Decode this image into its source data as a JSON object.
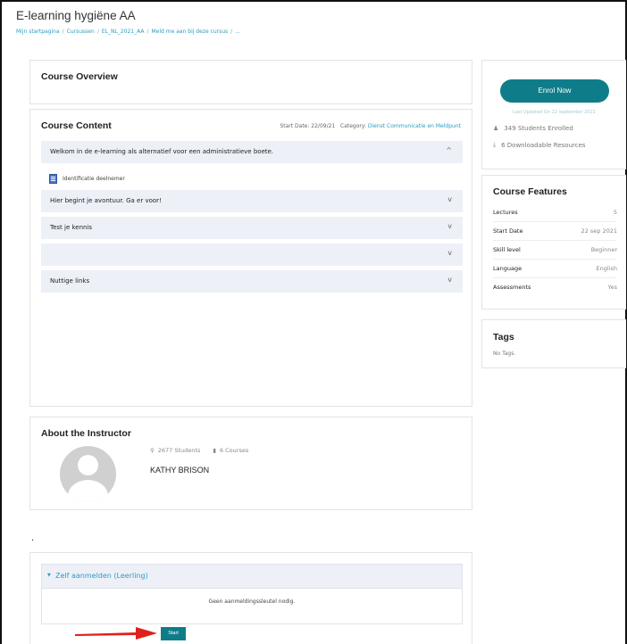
{
  "page": {
    "title": "E-learning hygiëne AA",
    "breadcrumb": [
      "Mijn startpagina",
      "Cursussen",
      "EL_NL_2021_AA",
      "Meld me aan bij deze cursus",
      "..."
    ]
  },
  "overview": {
    "title": "Course Overview"
  },
  "content": {
    "title": "Course Content",
    "start_label": "Start Date: 22/09/21",
    "category_label": "Category:",
    "category": "Dienst Communicatie en Meldpunt",
    "sections": [
      {
        "label": "Welkom in de e-learning als alternatief voor een administratieve boete.",
        "chevron": "^"
      },
      {
        "label": "Hier begint je avontuur. Ga er voor!",
        "chevron": "v"
      },
      {
        "label": "Test je kennis",
        "chevron": "v"
      },
      {
        "label": "",
        "chevron": "v"
      },
      {
        "label": "Nuttige links",
        "chevron": "v"
      }
    ],
    "activity": "Identificatie deelnemer"
  },
  "instructor": {
    "title": "About the Instructor",
    "students": "2677 Students",
    "courses": "6 Courses",
    "name": "KATHY BRISON"
  },
  "separator": ".",
  "enrol": {
    "method": "Zelf aanmelden (Leerling)",
    "message": "Geen aanmeldingssleutel nodig.",
    "start_label": "Start"
  },
  "sidebar": {
    "enrol_now": "Enrol Now",
    "updated": "Last Updated On 22 september 2021",
    "students_enrolled": "349 Students Enrolled",
    "resources": "6 Downloadable Resources",
    "features_title": "Course Features",
    "features": [
      {
        "key": "Lectures",
        "value": "5"
      },
      {
        "key": "Start Date",
        "value": "22 sep 2021"
      },
      {
        "key": "Skill level",
        "value": "Beginner"
      },
      {
        "key": "Language",
        "value": "English"
      },
      {
        "key": "Assessments",
        "value": "Yes"
      }
    ],
    "tags_title": "Tags",
    "tags_empty": "No Tags."
  },
  "colors": {
    "accent": "#0f7d89",
    "link": "#2a9dc0",
    "section_bg": "#eef0f8",
    "arrow": "#e0201b"
  },
  "icons": {
    "students": "user-icon",
    "courses": "book-icon",
    "enrolled": "person-icon",
    "resources": "download-icon",
    "activity": "document-icon"
  }
}
